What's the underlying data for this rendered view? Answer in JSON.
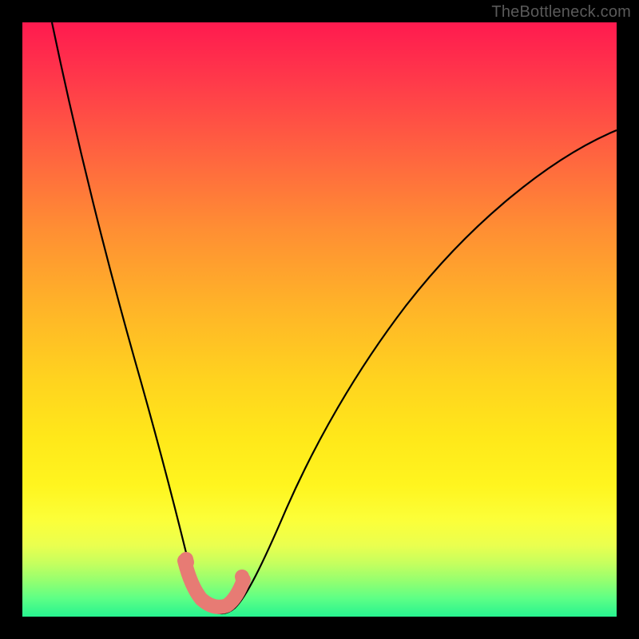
{
  "watermark": "TheBottleneck.com",
  "chart_data": {
    "type": "line",
    "title": "",
    "xlabel": "",
    "ylabel": "",
    "xlim": [
      0,
      100
    ],
    "ylim": [
      0,
      100
    ],
    "grid": false,
    "legend": false,
    "background_gradient": {
      "top": "#ff1a4f",
      "mid": "#ffd31f",
      "bottom": "#27f38f"
    },
    "series": [
      {
        "name": "curve",
        "color": "#000000",
        "x": [
          5,
          10,
          15,
          20,
          24,
          27,
          29,
          31,
          33,
          35,
          38,
          42,
          47,
          55,
          65,
          78,
          92,
          100
        ],
        "y": [
          100,
          80,
          61,
          42,
          26,
          14,
          7,
          2,
          0,
          0,
          2,
          7,
          14,
          27,
          42,
          58,
          72,
          79
        ]
      },
      {
        "name": "highlight_band",
        "color": "#e77b74",
        "x": [
          27.5,
          29,
          31,
          33,
          35,
          36.8
        ],
        "y": [
          9,
          4,
          1.3,
          1.2,
          3.5,
          8.5
        ]
      }
    ],
    "notes": "V-shaped bottleneck curve on a red-to-green gradient; the minimum sits near x≈33% and touches the green band. Salmon-colored rounded markers highlight the bottom of the V."
  }
}
